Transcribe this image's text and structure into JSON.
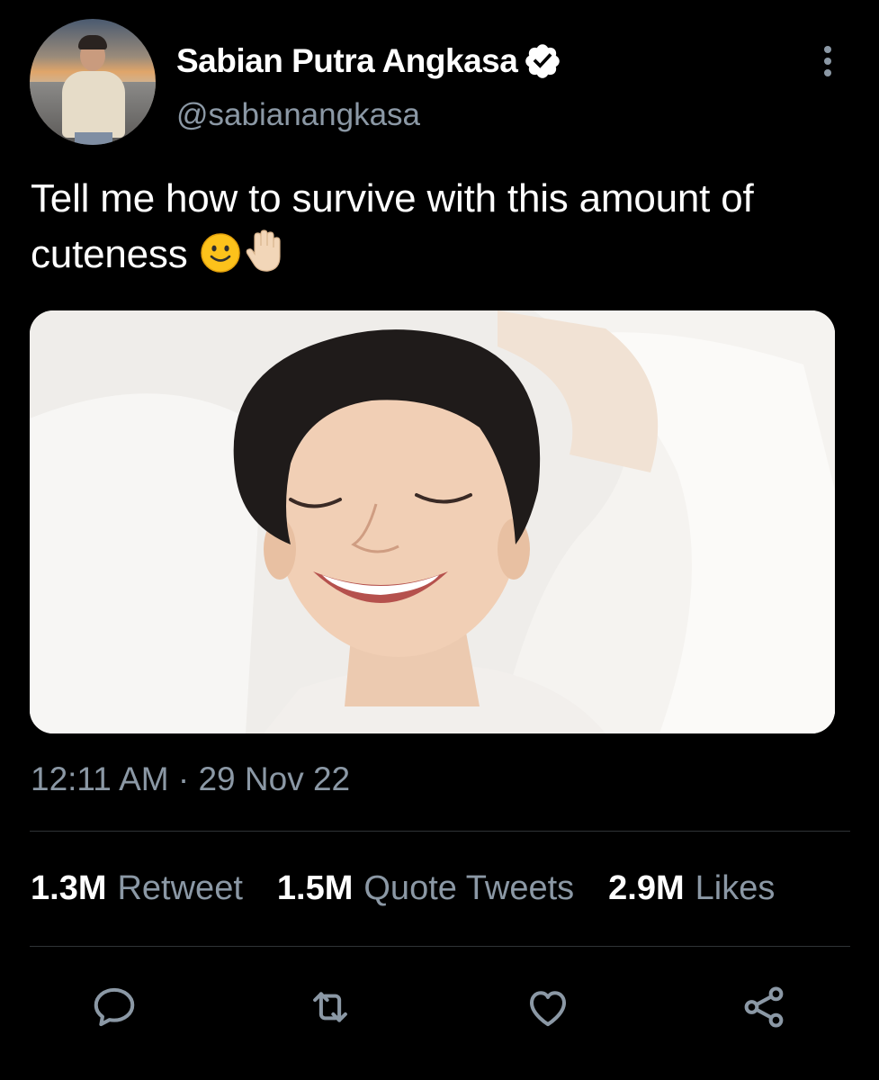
{
  "author": {
    "display_name": "Sabian Putra Angkasa",
    "handle": "@sabianangkasa",
    "verified": true,
    "avatar_icon": "profile-photo"
  },
  "tweet": {
    "text": "Tell me how to survive with this amount of cuteness",
    "emojis": [
      "🙂",
      "✋🏼"
    ],
    "timestamp": "12:11 AM · 29 Nov 22",
    "media_description_icon": "photo"
  },
  "stats": [
    {
      "count": "1.3M",
      "label": "Retweet"
    },
    {
      "count": "1.5M",
      "label": "Quote Tweets"
    },
    {
      "count": "2.9M",
      "label": "Likes"
    }
  ],
  "actions": {
    "reply_icon": "reply-icon",
    "retweet_icon": "retweet-icon",
    "like_icon": "heart-icon",
    "share_icon": "share-icon"
  },
  "colors": {
    "background": "#000000",
    "text_primary": "#ffffff",
    "text_secondary": "#8b98a5",
    "divider": "#2f3336",
    "verified_badge": "#ffffff"
  }
}
